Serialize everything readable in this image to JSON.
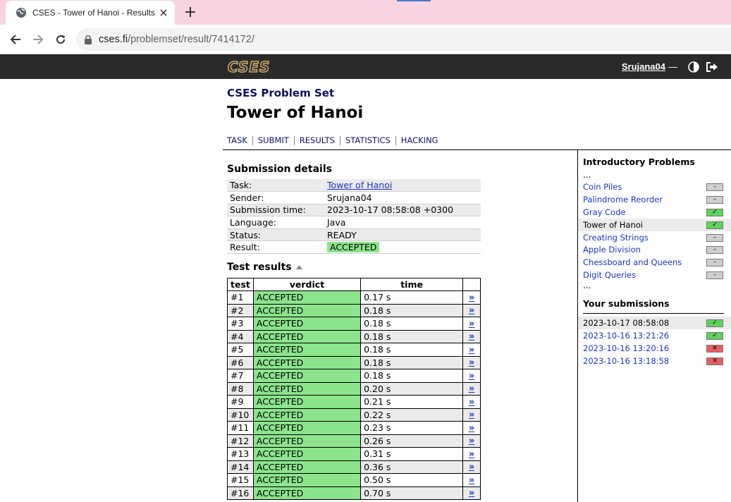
{
  "browser": {
    "tab_title": "CSES - Tower of Hanoi - Results",
    "url_host": "cses.fi",
    "url_path": "/problemset/result/7414172/"
  },
  "site": {
    "logo_text": "CSES",
    "username": "Srujana04",
    "user_separator": "—"
  },
  "page": {
    "problemset": "CSES Problem Set",
    "title": "Tower of Hanoi",
    "nav": [
      "TASK",
      "SUBMIT",
      "RESULTS",
      "STATISTICS",
      "HACKING"
    ]
  },
  "details": {
    "heading": "Submission details",
    "rows": [
      {
        "key": "Task:",
        "value": "Tower of Hanoi"
      },
      {
        "key": "Sender:",
        "value": "Srujana04"
      },
      {
        "key": "Submission time:",
        "value": "2023-10-17 08:58:08 +0300"
      },
      {
        "key": "Language:",
        "value": "Java"
      },
      {
        "key": "Status:",
        "value": "READY"
      },
      {
        "key": "Result:",
        "value": "ACCEPTED"
      }
    ]
  },
  "tests": {
    "heading": "Test results",
    "columns": [
      "test",
      "verdict",
      "time"
    ],
    "link_glyph": "»",
    "rows": [
      {
        "test": "#1",
        "verdict": "ACCEPTED",
        "time": "0.17 s"
      },
      {
        "test": "#2",
        "verdict": "ACCEPTED",
        "time": "0.18 s"
      },
      {
        "test": "#3",
        "verdict": "ACCEPTED",
        "time": "0.18 s"
      },
      {
        "test": "#4",
        "verdict": "ACCEPTED",
        "time": "0.18 s"
      },
      {
        "test": "#5",
        "verdict": "ACCEPTED",
        "time": "0.18 s"
      },
      {
        "test": "#6",
        "verdict": "ACCEPTED",
        "time": "0.18 s"
      },
      {
        "test": "#7",
        "verdict": "ACCEPTED",
        "time": "0.18 s"
      },
      {
        "test": "#8",
        "verdict": "ACCEPTED",
        "time": "0.20 s"
      },
      {
        "test": "#9",
        "verdict": "ACCEPTED",
        "time": "0.21 s"
      },
      {
        "test": "#10",
        "verdict": "ACCEPTED",
        "time": "0.22 s"
      },
      {
        "test": "#11",
        "verdict": "ACCEPTED",
        "time": "0.23 s"
      },
      {
        "test": "#12",
        "verdict": "ACCEPTED",
        "time": "0.26 s"
      },
      {
        "test": "#13",
        "verdict": "ACCEPTED",
        "time": "0.31 s"
      },
      {
        "test": "#14",
        "verdict": "ACCEPTED",
        "time": "0.36 s"
      },
      {
        "test": "#15",
        "verdict": "ACCEPTED",
        "time": "0.50 s"
      },
      {
        "test": "#16",
        "verdict": "ACCEPTED",
        "time": "0.70 s"
      }
    ]
  },
  "sidebar": {
    "problems_heading": "Introductory Problems",
    "ellipsis": "...",
    "problems": [
      {
        "name": "Coin Piles",
        "status": "none",
        "mark": "–",
        "current": false
      },
      {
        "name": "Palindrome Reorder",
        "status": "none",
        "mark": "–",
        "current": false
      },
      {
        "name": "Gray Code",
        "status": "ok",
        "mark": "✓",
        "current": false
      },
      {
        "name": "Tower of Hanoi",
        "status": "ok",
        "mark": "✓",
        "current": true
      },
      {
        "name": "Creating Strings",
        "status": "none",
        "mark": "–",
        "current": false
      },
      {
        "name": "Apple Division",
        "status": "none",
        "mark": "–",
        "current": false
      },
      {
        "name": "Chessboard and Queens",
        "status": "none",
        "mark": "–",
        "current": false
      },
      {
        "name": "Digit Queries",
        "status": "none",
        "mark": "–",
        "current": false
      }
    ],
    "submissions_heading": "Your submissions",
    "submissions": [
      {
        "time": "2023-10-17 08:58:08",
        "status": "ok",
        "mark": "✓",
        "current": true
      },
      {
        "time": "2023-10-16 13:21:26",
        "status": "ok",
        "mark": "✓",
        "current": false
      },
      {
        "time": "2023-10-16 13:20:16",
        "status": "fail",
        "mark": "✕",
        "current": false
      },
      {
        "time": "2023-10-16 13:18:58",
        "status": "fail",
        "mark": "✕",
        "current": false
      }
    ]
  },
  "colors": {
    "tabbar_bg": "#f8d3e2",
    "site_header_bg": "#2a2a2a",
    "accepted_green": "#8ce48c",
    "link_blue": "#1a35c8",
    "status_ok": "#5ed35e",
    "status_fail": "#e46060"
  }
}
